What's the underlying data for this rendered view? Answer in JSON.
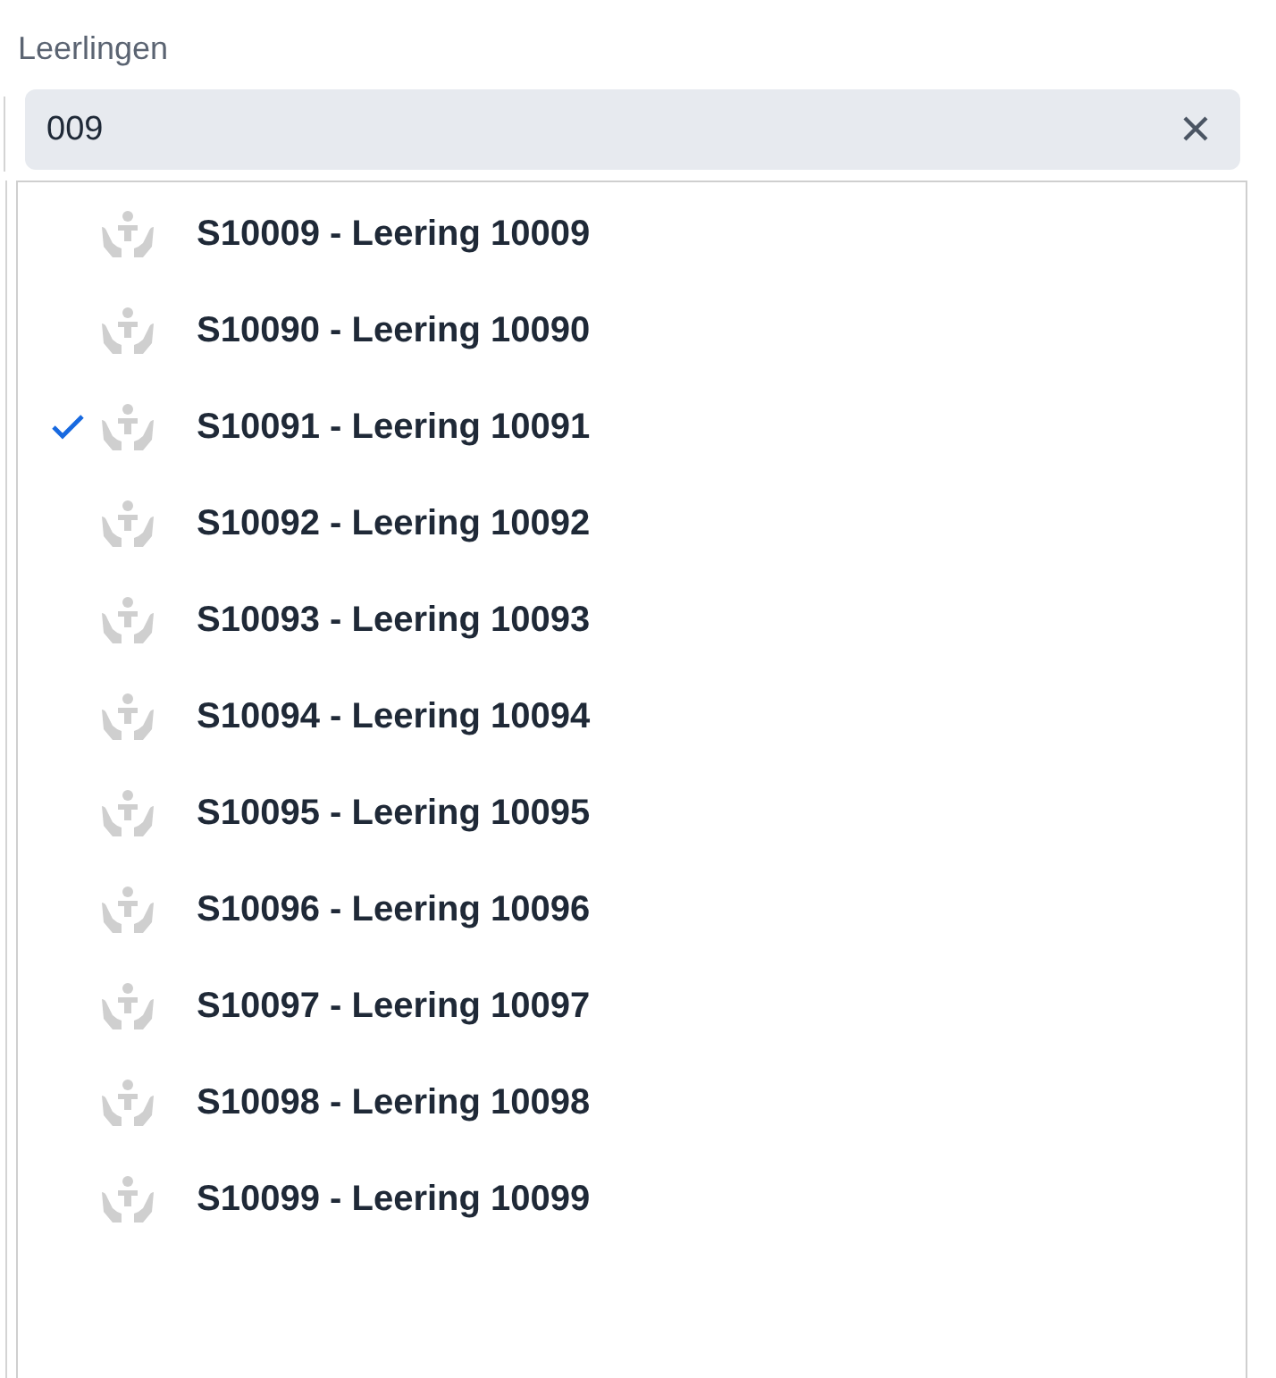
{
  "field": {
    "label": "Leerlingen",
    "value": "009"
  },
  "options": [
    {
      "label": "S10009 - Leering 10009",
      "selected": false
    },
    {
      "label": "S10090 - Leering 10090",
      "selected": false
    },
    {
      "label": "S10091 - Leering 10091",
      "selected": true
    },
    {
      "label": "S10092 - Leering 10092",
      "selected": false
    },
    {
      "label": "S10093 - Leering 10093",
      "selected": false
    },
    {
      "label": "S10094 - Leering 10094",
      "selected": false
    },
    {
      "label": "S10095 - Leering 10095",
      "selected": false
    },
    {
      "label": "S10096 - Leering 10096",
      "selected": false
    },
    {
      "label": "S10097 - Leering 10097",
      "selected": false
    },
    {
      "label": "S10098 - Leering 10098",
      "selected": false
    },
    {
      "label": "S10099 - Leering 10099",
      "selected": false
    }
  ]
}
